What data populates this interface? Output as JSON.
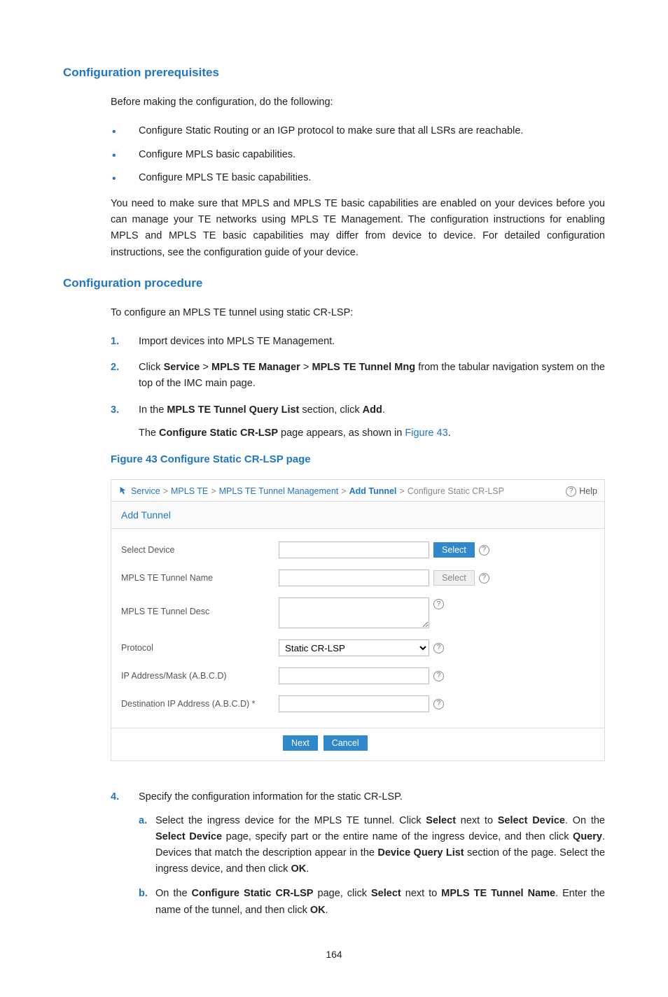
{
  "section1": {
    "title": "Configuration prerequisites",
    "intro": "Before making the configuration, do the following:",
    "bullets": [
      "Configure Static Routing or an IGP protocol to make sure that all LSRs are reachable.",
      "Configure MPLS basic capabilities.",
      "Configure MPLS TE basic capabilities."
    ],
    "para2": "You need to make sure that MPLS and MPLS TE basic capabilities are enabled on your devices before you can manage your TE networks using MPLS TE Management. The configuration instructions for enabling MPLS and MPLS TE basic capabilities may differ from device to device. For detailed configuration instructions, see the configuration guide of your device."
  },
  "section2": {
    "title": "Configuration procedure",
    "intro": "To configure an MPLS TE tunnel using static CR-LSP:",
    "step1": "Import devices into MPLS TE Management.",
    "step2": {
      "pre": "Click ",
      "b1": "Service",
      "sep1": " > ",
      "b2": "MPLS TE Manager",
      "sep2": " > ",
      "b3": "MPLS TE Tunnel Mng",
      "post": " from the tabular navigation system on the top of the IMC main page."
    },
    "step3": {
      "line1_pre": "In the ",
      "line1_b1": "MPLS TE Tunnel Query List",
      "line1_mid": " section, click ",
      "line1_b2": "Add",
      "line1_post": ".",
      "line2_pre": "The ",
      "line2_b1": "Configure Static CR-LSP",
      "line2_mid": " page appears, as shown in ",
      "line2_link": "Figure 43",
      "line2_post": "."
    },
    "fig_caption": "Figure 43 Configure Static CR-LSP page",
    "step4": {
      "intro": "Specify the configuration information for the static CR-LSP.",
      "a": {
        "t1": "Select the ingress device for the MPLS TE tunnel. Click ",
        "b1": "Select",
        "t2": " next to ",
        "b2": "Select Device",
        "t3": ". On the ",
        "b3": "Select Device",
        "t4": " page, specify part or the entire name of the ingress device, and then click ",
        "b4": "Query",
        "t5": ". Devices that match the description appear in the ",
        "b5": "Device Query List",
        "t6": " section of the page. Select the ingress device, and then click ",
        "b6": "OK",
        "t7": "."
      },
      "b": {
        "t1": "On the ",
        "b1": "Configure Static CR-LSP",
        "t2": " page, click ",
        "b2": "Select",
        "t3": " next to ",
        "b3": "MPLS TE Tunnel Name",
        "t4": ". Enter the name of the tunnel, and then click ",
        "b4": "OK",
        "t5": "."
      }
    }
  },
  "figure": {
    "breadcrumb": {
      "a1": "Service",
      "a2": "MPLS TE",
      "a3": "MPLS TE Tunnel Management",
      "a4": "Add Tunnel",
      "a5": "Configure Static CR-LSP",
      "sep": ">"
    },
    "help": "Help",
    "panel_title": "Add Tunnel",
    "labels": {
      "select_device": "Select Device",
      "tunnel_name": "MPLS TE Tunnel Name",
      "tunnel_desc": "MPLS TE Tunnel Desc",
      "protocol": "Protocol",
      "ip_mask": "IP Address/Mask (A.B.C.D)",
      "dest_ip": "Destination IP Address (A.B.C.D) *"
    },
    "protocol_value": "Static CR-LSP",
    "select_btn": "Select",
    "next": "Next",
    "cancel": "Cancel"
  },
  "page_number": "164"
}
